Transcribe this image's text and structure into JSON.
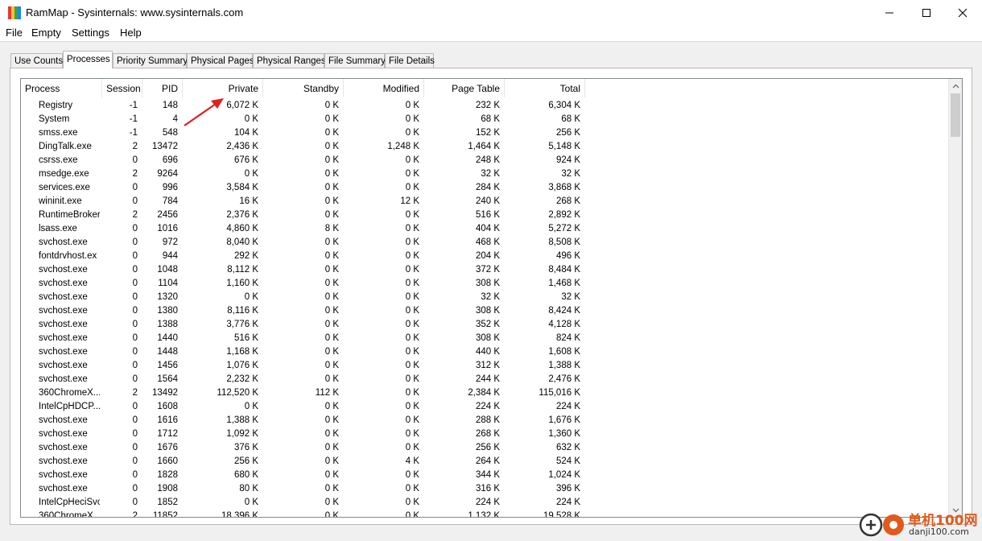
{
  "window": {
    "title": "RamMap - Sysinternals: www.sysinternals.com",
    "icon": "rammap-app-icon",
    "controls": [
      "minimize-icon",
      "maximize-icon",
      "close-icon"
    ]
  },
  "menu": [
    "File",
    "Empty",
    "Settings",
    "Help"
  ],
  "tabs": [
    {
      "label": "Use Counts",
      "active": false
    },
    {
      "label": "Processes",
      "active": true
    },
    {
      "label": "Priority Summary",
      "active": false
    },
    {
      "label": "Physical Pages",
      "active": false
    },
    {
      "label": "Physical Ranges",
      "active": false
    },
    {
      "label": "File Summary",
      "active": false
    },
    {
      "label": "File Details",
      "active": false
    }
  ],
  "columns": [
    "Process",
    "Session",
    "PID",
    "Private",
    "Standby",
    "Modified",
    "Page Table",
    "Total"
  ],
  "rows": [
    [
      "Registry",
      "-1",
      "148",
      "6,072 K",
      "0 K",
      "0 K",
      "232 K",
      "6,304 K"
    ],
    [
      "System",
      "-1",
      "4",
      "0 K",
      "0 K",
      "0 K",
      "68 K",
      "68 K"
    ],
    [
      "smss.exe",
      "-1",
      "548",
      "104 K",
      "0 K",
      "0 K",
      "152 K",
      "256 K"
    ],
    [
      "DingTalk.exe",
      "2",
      "13472",
      "2,436 K",
      "0 K",
      "1,248 K",
      "1,464 K",
      "5,148 K"
    ],
    [
      "csrss.exe",
      "0",
      "696",
      "676 K",
      "0 K",
      "0 K",
      "248 K",
      "924 K"
    ],
    [
      "msedge.exe",
      "2",
      "9264",
      "0 K",
      "0 K",
      "0 K",
      "32 K",
      "32 K"
    ],
    [
      "services.exe",
      "0",
      "996",
      "3,584 K",
      "0 K",
      "0 K",
      "284 K",
      "3,868 K"
    ],
    [
      "wininit.exe",
      "0",
      "784",
      "16 K",
      "0 K",
      "12 K",
      "240 K",
      "268 K"
    ],
    [
      "RuntimeBroker.",
      "2",
      "2456",
      "2,376 K",
      "0 K",
      "0 K",
      "516 K",
      "2,892 K"
    ],
    [
      "lsass.exe",
      "0",
      "1016",
      "4,860 K",
      "8 K",
      "0 K",
      "404 K",
      "5,272 K"
    ],
    [
      "svchost.exe",
      "0",
      "972",
      "8,040 K",
      "0 K",
      "0 K",
      "468 K",
      "8,508 K"
    ],
    [
      "fontdrvhost.ex",
      "0",
      "944",
      "292 K",
      "0 K",
      "0 K",
      "204 K",
      "496 K"
    ],
    [
      "svchost.exe",
      "0",
      "1048",
      "8,112 K",
      "0 K",
      "0 K",
      "372 K",
      "8,484 K"
    ],
    [
      "svchost.exe",
      "0",
      "1104",
      "1,160 K",
      "0 K",
      "0 K",
      "308 K",
      "1,468 K"
    ],
    [
      "svchost.exe",
      "0",
      "1320",
      "0 K",
      "0 K",
      "0 K",
      "32 K",
      "32 K"
    ],
    [
      "svchost.exe",
      "0",
      "1380",
      "8,116 K",
      "0 K",
      "0 K",
      "308 K",
      "8,424 K"
    ],
    [
      "svchost.exe",
      "0",
      "1388",
      "3,776 K",
      "0 K",
      "0 K",
      "352 K",
      "4,128 K"
    ],
    [
      "svchost.exe",
      "0",
      "1440",
      "516 K",
      "0 K",
      "0 K",
      "308 K",
      "824 K"
    ],
    [
      "svchost.exe",
      "0",
      "1448",
      "1,168 K",
      "0 K",
      "0 K",
      "440 K",
      "1,608 K"
    ],
    [
      "svchost.exe",
      "0",
      "1456",
      "1,076 K",
      "0 K",
      "0 K",
      "312 K",
      "1,388 K"
    ],
    [
      "svchost.exe",
      "0",
      "1564",
      "2,232 K",
      "0 K",
      "0 K",
      "244 K",
      "2,476 K"
    ],
    [
      "360ChromeX...",
      "2",
      "13492",
      "112,520 K",
      "112 K",
      "0 K",
      "2,384 K",
      "115,016 K"
    ],
    [
      "IntelCpHDCP...",
      "0",
      "1608",
      "0 K",
      "0 K",
      "0 K",
      "224 K",
      "224 K"
    ],
    [
      "svchost.exe",
      "0",
      "1616",
      "1,388 K",
      "0 K",
      "0 K",
      "288 K",
      "1,676 K"
    ],
    [
      "svchost.exe",
      "0",
      "1712",
      "1,092 K",
      "0 K",
      "0 K",
      "268 K",
      "1,360 K"
    ],
    [
      "svchost.exe",
      "0",
      "1676",
      "376 K",
      "0 K",
      "0 K",
      "256 K",
      "632 K"
    ],
    [
      "svchost.exe",
      "0",
      "1660",
      "256 K",
      "0 K",
      "4 K",
      "264 K",
      "524 K"
    ],
    [
      "svchost.exe",
      "0",
      "1828",
      "680 K",
      "0 K",
      "0 K",
      "344 K",
      "1,024 K"
    ],
    [
      "svchost.exe",
      "0",
      "1908",
      "80 K",
      "0 K",
      "0 K",
      "316 K",
      "396 K"
    ],
    [
      "IntelCpHeciSvc",
      "0",
      "1852",
      "0 K",
      "0 K",
      "0 K",
      "224 K",
      "224 K"
    ],
    [
      "360ChromeX...",
      "2",
      "11852",
      "18,396 K",
      "0 K",
      "0 K",
      "1,132 K",
      "19,528 K"
    ]
  ],
  "annotation": {
    "type": "arrow",
    "color": "#e02020",
    "points_to": "Private"
  },
  "watermark": {
    "line1": "单机100网",
    "line2": "danji100.com"
  }
}
